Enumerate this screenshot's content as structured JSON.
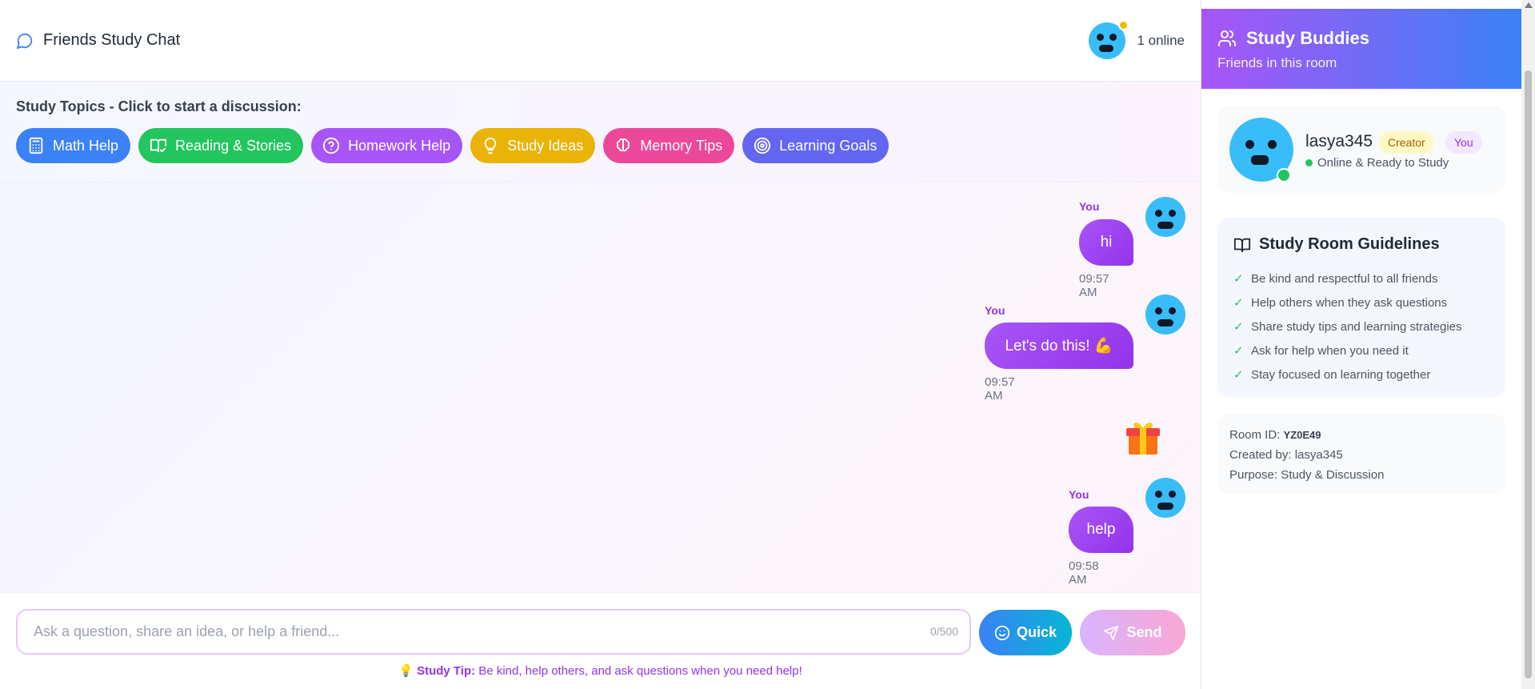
{
  "header": {
    "title": "Friends Study Chat",
    "online_count": "1 online"
  },
  "topics": {
    "heading": "Study Topics - Click to start a discussion:",
    "buttons": [
      {
        "label": "Math Help",
        "icon": "calculator-icon",
        "color": "#3b82f6"
      },
      {
        "label": "Reading & Stories",
        "icon": "book-check-icon",
        "color": "#22c55e"
      },
      {
        "label": "Homework Help",
        "icon": "question-circle-icon",
        "color": "#a855f7"
      },
      {
        "label": "Study Ideas",
        "icon": "lightbulb-icon",
        "color": "#eab308"
      },
      {
        "label": "Memory Tips",
        "icon": "brain-icon",
        "color": "#ec4899"
      },
      {
        "label": "Learning Goals",
        "icon": "target-icon",
        "color": "#6366f1"
      }
    ]
  },
  "messages": [
    {
      "sender": "You",
      "text": "hi",
      "time": "09:57 AM"
    },
    {
      "sender": "You",
      "text": "Let's do this! 💪",
      "time": "09:57 AM"
    },
    {
      "sender": "",
      "text": "",
      "time": "",
      "sticker": "gift-icon"
    },
    {
      "sender": "You",
      "text": "help",
      "time": "09:58 AM"
    }
  ],
  "composer": {
    "placeholder": "Ask a question, share an idea, or help a friend...",
    "value": "",
    "counter": "0/500",
    "quick_label": "Quick",
    "send_label": "Send",
    "tip_label": "Study Tip:",
    "tip_text": " Be kind, help others, and ask questions when you need help!"
  },
  "sidebar": {
    "title": "Study Buddies",
    "subtitle": "Friends in this room",
    "user": {
      "name": "lasya345",
      "tag_creator": "Creator",
      "tag_you": "You",
      "status": "Online & Ready to Study"
    },
    "guidelines": {
      "title": "Study Room Guidelines",
      "items": [
        "Be kind and respectful to all friends",
        "Help others when they ask questions",
        "Share study tips and learning strategies",
        "Ask for help when you need it",
        "Stay focused on learning together"
      ]
    },
    "room": {
      "id_label": "Room ID:",
      "id_value": "YZ0E49",
      "created_by": "Created by: lasya345",
      "purpose": "Purpose: Study & Discussion"
    }
  },
  "colors": {
    "accent_purple": "#a855f7",
    "accent_blue": "#3b82f6",
    "online_green": "#22c55e"
  }
}
